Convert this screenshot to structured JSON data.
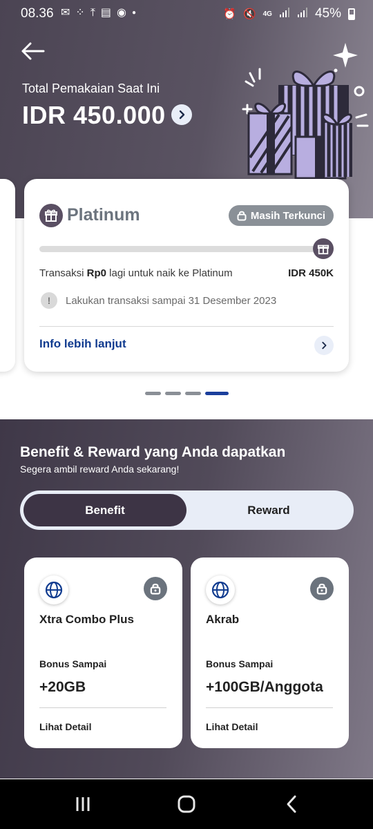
{
  "status_bar": {
    "time": "08.36",
    "battery": "45%",
    "network": "4G"
  },
  "header": {
    "subtitle": "Total Pemakaian Saat Ini",
    "amount": "IDR 450.000"
  },
  "tier_card": {
    "tier_name": "Platinum",
    "lock_badge": "Masih Terkunci",
    "progress_fraction": 1.0,
    "tx_prefix": "Transaksi ",
    "tx_amount": "Rp0",
    "tx_suffix": " lagi untuk naik ke Platinum",
    "tx_target": "IDR 450K",
    "info_text": "Lakukan transaksi sampai 31 Desember 2023",
    "more_link": "Info lebih lanjut"
  },
  "pager": {
    "total": 4,
    "active_index": 3
  },
  "benefit_section": {
    "title": "Benefit & Reward yang Anda dapatkan",
    "subtitle": "Segera ambil reward Anda sekarang!",
    "tabs": [
      {
        "label": "Benefit",
        "active": true
      },
      {
        "label": "Reward",
        "active": false
      }
    ],
    "cards": [
      {
        "name": "Xtra Combo Plus",
        "bonus_label": "Bonus Sampai",
        "bonus_value": "+20GB",
        "detail_link": "Lihat Detail",
        "icon": "globe-icon"
      },
      {
        "name": "Akrab",
        "bonus_label": "Bonus Sampai",
        "bonus_value": "+100GB/Anggota",
        "detail_link": "Lihat Detail",
        "icon": "globe-icon"
      }
    ]
  },
  "colors": {
    "header_bg": "#4b4453",
    "accent_dark": "#3d3445",
    "link_blue": "#103b8f",
    "pager_active": "#1b3f9c",
    "tier_grey": "#6c747e"
  }
}
